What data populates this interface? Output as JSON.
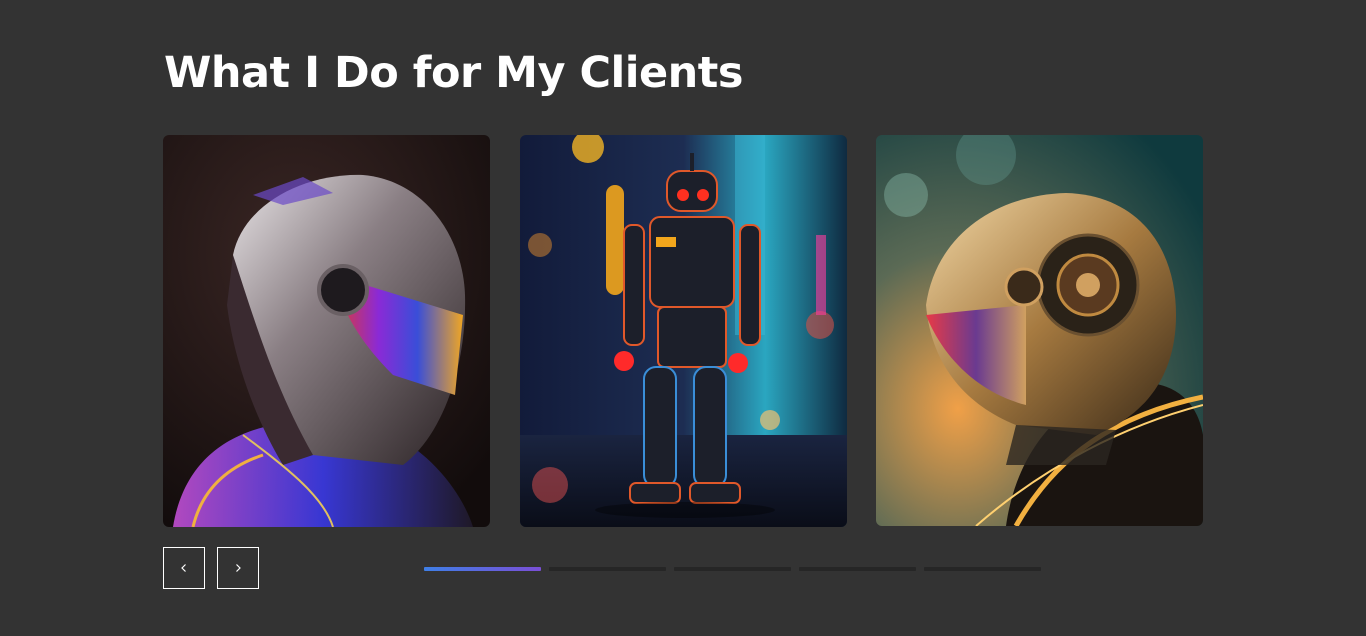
{
  "section": {
    "title": "What I Do for My Clients"
  },
  "cards": [
    {
      "icon": "chrome-helmet-robot-image"
    },
    {
      "icon": "walking-toy-robot-image"
    },
    {
      "icon": "gold-helmet-robot-image"
    }
  ],
  "controls": {
    "prev_icon": "chevron-left-icon",
    "next_icon": "chevron-right-icon"
  },
  "pagination": {
    "count": 5,
    "active_index": 0,
    "active_gradient": [
      "#3f7fe6",
      "#7a4fd6"
    ],
    "inactive_color": "#262626"
  },
  "colors": {
    "background": "#333333",
    "text": "#ffffff"
  }
}
